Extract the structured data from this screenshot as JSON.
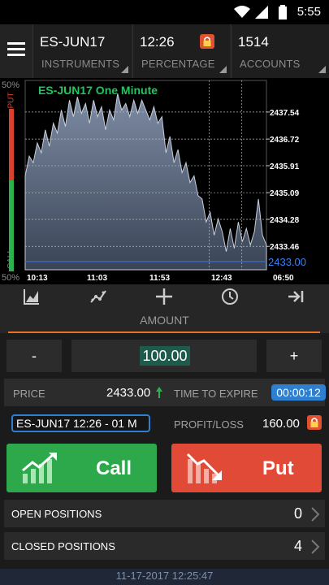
{
  "status_bar": {
    "time": "5:55"
  },
  "header": {
    "instrument": {
      "value": "ES-JUN17",
      "label": "INSTRUMENTS"
    },
    "percentage": {
      "value": "12:26",
      "label": "PERCENTAGE"
    },
    "accounts": {
      "value": "1514",
      "label": "ACCOUNTS"
    }
  },
  "chart_side": {
    "top_pct": "50%",
    "bottom_pct": "50%",
    "put_label": "PUT",
    "call_label": "CALL",
    "put_color": "#d9412e",
    "call_color": "#2bb24c"
  },
  "chart_data": {
    "type": "area",
    "title": "ES-JUN17 One Minute",
    "y_ticks": [
      2437.54,
      2436.72,
      2435.91,
      2435.09,
      2434.28,
      2433.46
    ],
    "y_ticks_labels": [
      "2437.54",
      "2436.72",
      "2435.91",
      "2435.09",
      "2434.28",
      "2433.46"
    ],
    "current_price_label": "2433.00",
    "current_price": 2433.0,
    "x_ticks": [
      "10:13",
      "11:03",
      "11:53",
      "12:43",
      "06:50"
    ],
    "ylim": [
      2432.75,
      2438.5
    ],
    "grid": true,
    "fill_color": "#6f7f98",
    "line_color": "#c8d0dc",
    "price_line_color": "#2f6fe0",
    "values": [
      2435.6,
      2436.2,
      2436.0,
      2436.6,
      2436.3,
      2437.0,
      2436.5,
      2437.2,
      2436.9,
      2437.6,
      2437.1,
      2437.9,
      2437.4,
      2438.0,
      2437.5,
      2437.8,
      2437.2,
      2437.9,
      2437.4,
      2437.7,
      2437.0,
      2437.6,
      2437.3,
      2438.1,
      2437.6,
      2437.8,
      2437.4,
      2437.9,
      2437.5,
      2437.9,
      2437.6,
      2437.3,
      2437.7,
      2437.2,
      2437.4,
      2436.3,
      2436.8,
      2436.0,
      2436.4,
      2435.7,
      2436.0,
      2435.4,
      2435.6,
      2435.0,
      2434.9,
      2434.2,
      2434.5,
      2433.8,
      2434.3,
      2433.9,
      2433.3,
      2434.0,
      2433.4,
      2434.2,
      2433.6,
      2434.0,
      2433.5,
      2433.9,
      2434.9,
      2433.8,
      2433.5
    ]
  },
  "toolbar": {
    "icons": [
      "chart-type-icon",
      "indicators-icon",
      "crosshair-icon",
      "clock-icon",
      "scroll-end-icon"
    ]
  },
  "amount": {
    "title": "AMOUNT",
    "minus": "-",
    "plus": "+",
    "value": "100.00"
  },
  "trade_info": {
    "price_label": "PRICE",
    "price_value": "2433.00",
    "expire_label": "TIME TO EXPIRE",
    "expire_value": "00:00:12",
    "option_selected": "ES-JUN17 12:26 - 01 M",
    "profit_label": "PROFIT/LOSS",
    "profit_value": "160.00"
  },
  "buttons": {
    "call": "Call",
    "put": "Put",
    "call_color": "#2da94c",
    "put_color": "#e04a36"
  },
  "positions": [
    {
      "label": "OPEN POSITIONS",
      "count": "0"
    },
    {
      "label": "CLOSED POSITIONS",
      "count": "4"
    }
  ],
  "footer": {
    "datetime": "11-17-2017 12:25:47"
  }
}
